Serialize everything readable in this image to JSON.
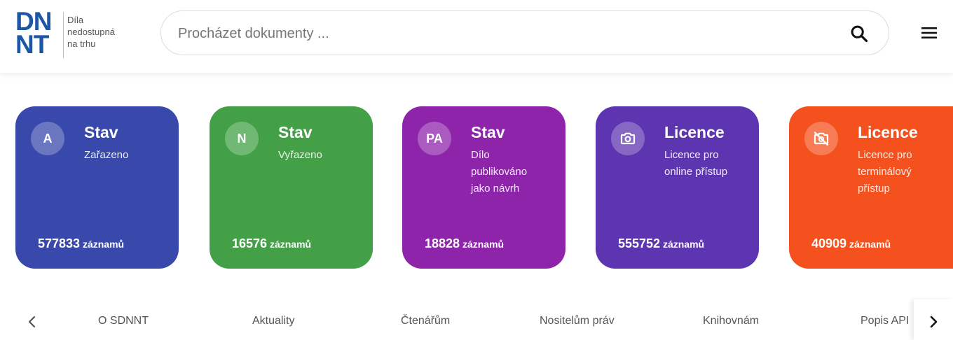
{
  "header": {
    "logo": {
      "line1": "DN",
      "line2": "NT",
      "text1": "Díla",
      "text2": "nedostupná",
      "text3": "na trhu"
    },
    "search": {
      "placeholder": "Procházet dokumenty ...",
      "value": "",
      "icon": "search-icon"
    },
    "menu_icon": "hamburger-menu-icon"
  },
  "cards": [
    {
      "badge": "A",
      "title": "Stav",
      "subtitle": "Zařazeno",
      "count": "577833",
      "count_label": "záznamů",
      "color": "#3949ab"
    },
    {
      "badge": "N",
      "title": "Stav",
      "subtitle": "Vyřazeno",
      "count": "16576",
      "count_label": "záznamů",
      "color": "#43a047"
    },
    {
      "badge": "PA",
      "title": "Stav",
      "subtitle": "Dílo publikováno jako návrh",
      "count": "18828",
      "count_label": "záznamů",
      "color": "#8e24aa"
    },
    {
      "badge_icon": "camera-icon",
      "title": "Licence",
      "subtitle": "Licence pro online přístup",
      "count": "555752",
      "count_label": "záznamů",
      "color": "#5e35b1"
    },
    {
      "badge_icon": "no-photography-icon",
      "title": "Licence",
      "subtitle": "Licence pro terminálový přístup",
      "count": "40909",
      "count_label": "záznamů",
      "color": "#f4511e"
    }
  ],
  "nav": {
    "items": [
      "O SDNNT",
      "Aktuality",
      "Čtenářům",
      "Nositelům práv",
      "Knihovnám",
      "Popis API"
    ],
    "prev_icon": "chevron-left-icon",
    "next_icon": "chevron-right-icon"
  }
}
